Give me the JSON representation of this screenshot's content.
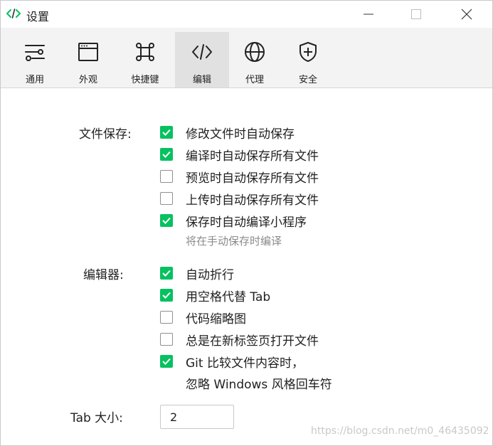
{
  "window": {
    "title": "设置",
    "app_icon": "code-brackets-icon",
    "controls": [
      "minimize-icon",
      "maximize-icon",
      "close-icon"
    ]
  },
  "tabs": [
    {
      "label": "通用",
      "icon": "sliders-icon",
      "active": false
    },
    {
      "label": "外观",
      "icon": "browser-window-icon",
      "active": false
    },
    {
      "label": "快捷键",
      "icon": "command-key-icon",
      "active": false
    },
    {
      "label": "编辑",
      "icon": "code-icon",
      "active": true
    },
    {
      "label": "代理",
      "icon": "globe-icon",
      "active": false
    },
    {
      "label": "安全",
      "icon": "shield-plus-icon",
      "active": false
    }
  ],
  "file_save": {
    "label": "文件保存:",
    "options": [
      {
        "label": "修改文件时自动保存",
        "checked": true
      },
      {
        "label": "编译时自动保存所有文件",
        "checked": true
      },
      {
        "label": "预览时自动保存所有文件",
        "checked": false
      },
      {
        "label": "上传时自动保存所有文件",
        "checked": false
      },
      {
        "label": "保存时自动编译小程序",
        "checked": true
      }
    ],
    "hint": "将在手动保存时编译"
  },
  "editor": {
    "label": "编辑器:",
    "options": [
      {
        "label": "自动折行",
        "checked": true
      },
      {
        "label": "用空格代替 Tab",
        "checked": true
      },
      {
        "label": "代码缩略图",
        "checked": false
      },
      {
        "label": "总是在新标签页打开文件",
        "checked": false
      },
      {
        "label": "Git 比较文件内容时，",
        "checked": true
      }
    ],
    "option5_line2": "忽略 Windows 风格回车符"
  },
  "tab_size": {
    "label": "Tab 大小:",
    "value": "2"
  },
  "watermark": "https://blog.csdn.net/m0_46435092",
  "colors": {
    "accent": "#07c160",
    "hint": "#8a8a8a"
  }
}
